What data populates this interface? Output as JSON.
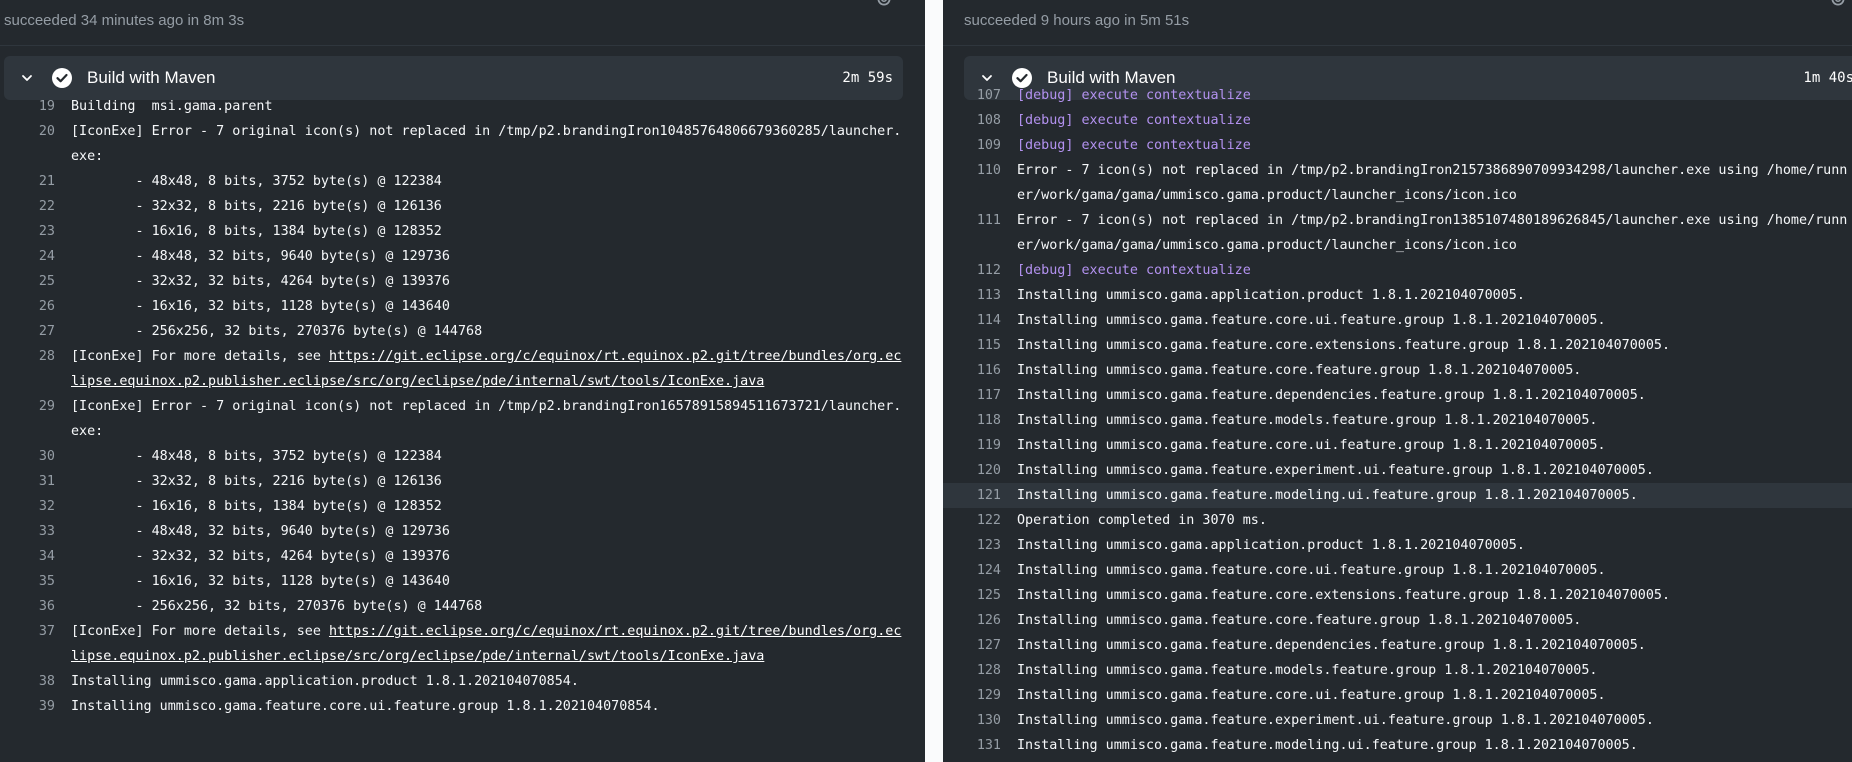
{
  "left": {
    "status": "succeeded 34 minutes ago in 8m 3s",
    "step_title": "Build with Maven",
    "step_duration": "2m 59s",
    "lines": [
      {
        "n": "19",
        "t": "Building  msi.gama.parent"
      },
      {
        "n": "20",
        "t": "[IconExe] Error - 7 original icon(s) not replaced in /tmp/p2.brandingIron10485764806679360285/launcher.exe:"
      },
      {
        "n": "21",
        "t": "        - 48x48, 8 bits, 3752 byte(s) @ 122384"
      },
      {
        "n": "22",
        "t": "        - 32x32, 8 bits, 2216 byte(s) @ 126136"
      },
      {
        "n": "23",
        "t": "        - 16x16, 8 bits, 1384 byte(s) @ 128352"
      },
      {
        "n": "24",
        "t": "        - 48x48, 32 bits, 9640 byte(s) @ 129736"
      },
      {
        "n": "25",
        "t": "        - 32x32, 32 bits, 4264 byte(s) @ 139376"
      },
      {
        "n": "26",
        "t": "        - 16x16, 32 bits, 1128 byte(s) @ 143640"
      },
      {
        "n": "27",
        "t": "        - 256x256, 32 bits, 270376 byte(s) @ 144768"
      },
      {
        "n": "28",
        "t": "[IconExe] For more details, see ",
        "link": "https://git.eclipse.org/c/equinox/rt.equinox.p2.git/tree/bundles/org.eclipse.equinox.p2.publisher.eclipse/src/org/eclipse/pde/internal/swt/tools/IconExe.java"
      },
      {
        "n": "29",
        "t": "[IconExe] Error - 7 original icon(s) not replaced in /tmp/p2.brandingIron16578915894511673721/launcher.exe:"
      },
      {
        "n": "30",
        "t": "        - 48x48, 8 bits, 3752 byte(s) @ 122384"
      },
      {
        "n": "31",
        "t": "        - 32x32, 8 bits, 2216 byte(s) @ 126136"
      },
      {
        "n": "32",
        "t": "        - 16x16, 8 bits, 1384 byte(s) @ 128352"
      },
      {
        "n": "33",
        "t": "        - 48x48, 32 bits, 9640 byte(s) @ 129736"
      },
      {
        "n": "34",
        "t": "        - 32x32, 32 bits, 4264 byte(s) @ 139376"
      },
      {
        "n": "35",
        "t": "        - 16x16, 32 bits, 1128 byte(s) @ 143640"
      },
      {
        "n": "36",
        "t": "        - 256x256, 32 bits, 270376 byte(s) @ 144768"
      },
      {
        "n": "37",
        "t": "[IconExe] For more details, see ",
        "link": "https://git.eclipse.org/c/equinox/rt.equinox.p2.git/tree/bundles/org.eclipse.equinox.p2.publisher.eclipse/src/org/eclipse/pde/internal/swt/tools/IconExe.java"
      },
      {
        "n": "38",
        "t": "Installing ummisco.gama.application.product 1.8.1.202104070854."
      },
      {
        "n": "39",
        "t": "Installing ummisco.gama.feature.core.ui.feature.group 1.8.1.202104070854."
      }
    ]
  },
  "right": {
    "status": "succeeded 9 hours ago in 5m 51s",
    "step_title": "Build with Maven",
    "step_duration": "1m 40s",
    "lines": [
      {
        "n": "107",
        "t": "[debug] execute contextualize",
        "debug": true
      },
      {
        "n": "108",
        "t": "[debug] execute contextualize",
        "debug": true
      },
      {
        "n": "109",
        "t": "[debug] execute contextualize",
        "debug": true
      },
      {
        "n": "110",
        "t": "Error - 7 icon(s) not replaced in /tmp/p2.brandingIron2157386890709934298/launcher.exe using /home/runner/work/gama/gama/ummisco.gama.product/launcher_icons/icon.ico"
      },
      {
        "n": "111",
        "t": "Error - 7 icon(s) not replaced in /tmp/p2.brandingIron1385107480189626845/launcher.exe using /home/runner/work/gama/gama/ummisco.gama.product/launcher_icons/icon.ico"
      },
      {
        "n": "112",
        "t": "[debug] execute contextualize",
        "debug": true
      },
      {
        "n": "113",
        "t": "Installing ummisco.gama.application.product 1.8.1.202104070005."
      },
      {
        "n": "114",
        "t": "Installing ummisco.gama.feature.core.ui.feature.group 1.8.1.202104070005."
      },
      {
        "n": "115",
        "t": "Installing ummisco.gama.feature.core.extensions.feature.group 1.8.1.202104070005."
      },
      {
        "n": "116",
        "t": "Installing ummisco.gama.feature.core.feature.group 1.8.1.202104070005."
      },
      {
        "n": "117",
        "t": "Installing ummisco.gama.feature.dependencies.feature.group 1.8.1.202104070005."
      },
      {
        "n": "118",
        "t": "Installing ummisco.gama.feature.models.feature.group 1.8.1.202104070005."
      },
      {
        "n": "119",
        "t": "Installing ummisco.gama.feature.core.ui.feature.group 1.8.1.202104070005."
      },
      {
        "n": "120",
        "t": "Installing ummisco.gama.feature.experiment.ui.feature.group 1.8.1.202104070005."
      },
      {
        "n": "121",
        "t": "Installing ummisco.gama.feature.modeling.ui.feature.group 1.8.1.202104070005.",
        "highlight": true
      },
      {
        "n": "122",
        "t": "Operation completed in 3070 ms."
      },
      {
        "n": "123",
        "t": "Installing ummisco.gama.application.product 1.8.1.202104070005."
      },
      {
        "n": "124",
        "t": "Installing ummisco.gama.feature.core.ui.feature.group 1.8.1.202104070005."
      },
      {
        "n": "125",
        "t": "Installing ummisco.gama.feature.core.extensions.feature.group 1.8.1.202104070005."
      },
      {
        "n": "126",
        "t": "Installing ummisco.gama.feature.core.feature.group 1.8.1.202104070005."
      },
      {
        "n": "127",
        "t": "Installing ummisco.gama.feature.dependencies.feature.group 1.8.1.202104070005."
      },
      {
        "n": "128",
        "t": "Installing ummisco.gama.feature.models.feature.group 1.8.1.202104070005."
      },
      {
        "n": "129",
        "t": "Installing ummisco.gama.feature.core.ui.feature.group 1.8.1.202104070005."
      },
      {
        "n": "130",
        "t": "Installing ummisco.gama.feature.experiment.ui.feature.group 1.8.1.202104070005."
      },
      {
        "n": "131",
        "t": "Installing ummisco.gama.feature.modeling.ui.feature.group 1.8.1.202104070005."
      }
    ]
  },
  "icons": {
    "settings": "gear-icon",
    "collapse": "chevron-down-icon",
    "success": "check-circle-icon"
  },
  "colors": {
    "background": "#24292e",
    "step_header": "#2f363d",
    "line_number": "#959da5",
    "debug_text": "#b392f0",
    "divider": "#fafbfc"
  }
}
